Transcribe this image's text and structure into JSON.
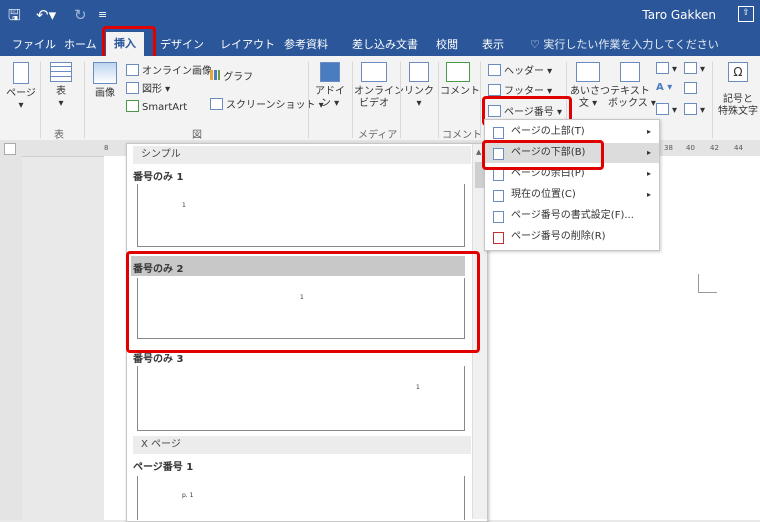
{
  "titlebar": {
    "user": "Taro Gakken"
  },
  "tabs": [
    "ファイル",
    "ホーム",
    "挿入",
    "デザイン",
    "レイアウト",
    "参考資料",
    "差し込み文書",
    "校閲",
    "表示"
  ],
  "search_placeholder": "実行したい作業を入力してください",
  "ribbon": {
    "page": "ページ",
    "table": "表",
    "picture": "画像",
    "online_picture": "オンライン画像",
    "shapes": "図形",
    "smartart": "SmartArt",
    "chart": "グラフ",
    "screenshot": "スクリーンショット",
    "addins_1": "アドイ",
    "addins_2": "ン",
    "online_video_1": "オンライン",
    "online_video_2": "ビデオ",
    "link": "リンク",
    "comment": "コメント",
    "header": "ヘッダー",
    "footer": "フッター",
    "page_number": "ページ番号",
    "aisatsu_1": "あいさつ",
    "aisatsu_2": "文",
    "textbox_1": "テキスト",
    "textbox_2": "ボックス",
    "symbol_1": "記号と",
    "symbol_2": "特殊文字",
    "groups": {
      "table": "表",
      "figure": "図",
      "media": "メディア",
      "comment": "コメント"
    }
  },
  "ruler": {
    "h_left": "8",
    "h_right": [
      "38",
      "40",
      "42",
      "44"
    ]
  },
  "gallery": {
    "section_simple": "シンプル",
    "item1": "番号のみ 1",
    "item2": "番号のみ 2",
    "item3": "番号のみ 3",
    "section_xpage": "X ページ",
    "item4": "ページ番号 1",
    "mark1": "1",
    "mark2": "1",
    "mark3": "1",
    "mark4": "p. 1"
  },
  "menu": {
    "items": [
      {
        "label": "ページの上部(T)",
        "arrow": "▸"
      },
      {
        "label": "ページの下部(B)",
        "arrow": "▸"
      },
      {
        "label": "ページの余白(P)",
        "arrow": "▸"
      },
      {
        "label": "現在の位置(C)",
        "arrow": "▸"
      },
      {
        "label": "ページ番号の書式設定(F)..."
      },
      {
        "label": "ページ番号の削除(R)"
      }
    ]
  }
}
